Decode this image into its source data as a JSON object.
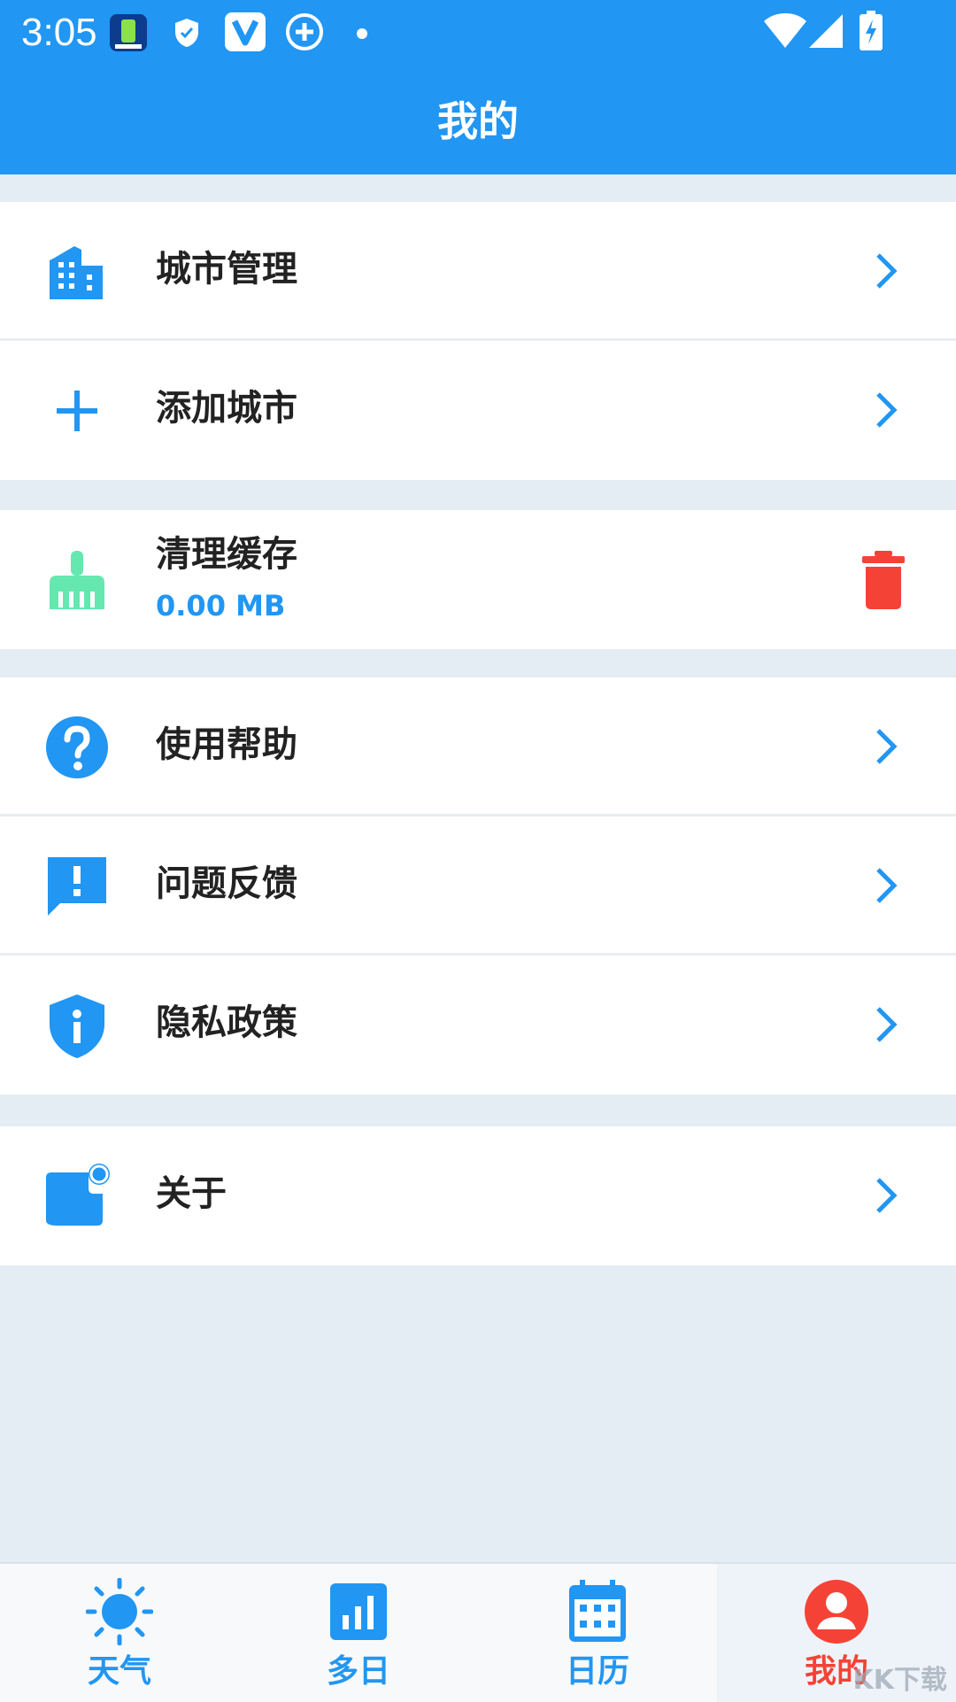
{
  "status_bar": {
    "time": "3:05"
  },
  "header": {
    "title": "我的"
  },
  "sections": [
    {
      "items": [
        {
          "label": "城市管理",
          "icon": "city-icon"
        },
        {
          "label": "添加城市",
          "icon": "add-icon"
        }
      ]
    },
    {
      "items": [
        {
          "label": "清理缓存",
          "sub": "0.00 MB",
          "icon": "broom-icon",
          "action": "trash-icon"
        }
      ]
    },
    {
      "items": [
        {
          "label": "使用帮助",
          "icon": "help-icon"
        },
        {
          "label": "问题反馈",
          "icon": "feedback-icon"
        },
        {
          "label": "隐私政策",
          "icon": "privacy-shield-icon"
        }
      ]
    },
    {
      "items": [
        {
          "label": "关于",
          "icon": "about-icon"
        }
      ]
    }
  ],
  "tabbar": {
    "tabs": [
      {
        "label": "天气",
        "icon": "sun-icon"
      },
      {
        "label": "多日",
        "icon": "bar-chart-icon"
      },
      {
        "label": "日历",
        "icon": "calendar-icon"
      },
      {
        "label": "我的",
        "icon": "user-icon",
        "active": true
      }
    ]
  },
  "watermark": "KK下载",
  "colors": {
    "primary": "#2196f3",
    "danger": "#f44336",
    "mint": "#64e8b0",
    "background": "#e4ecf4"
  }
}
